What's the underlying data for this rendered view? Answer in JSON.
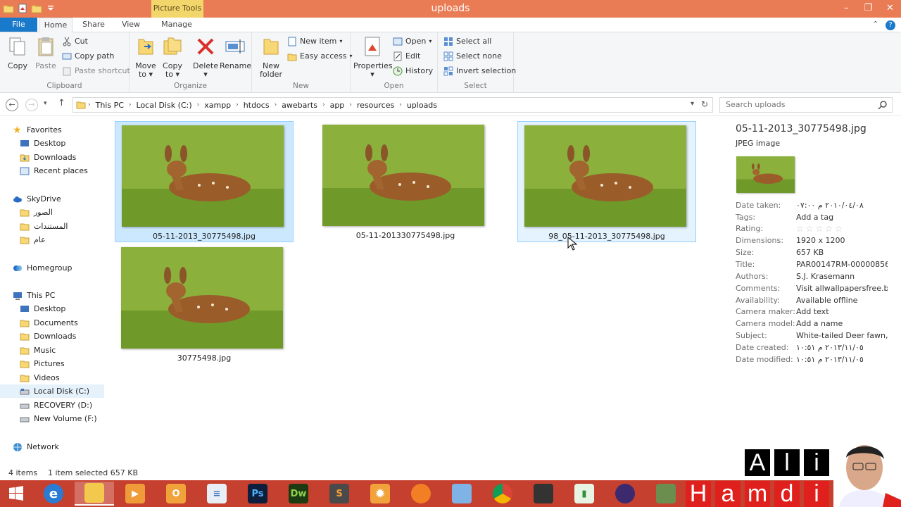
{
  "window": {
    "title": "uploads",
    "context_group": "Picture Tools",
    "controls": [
      "–",
      "❐",
      "✕"
    ]
  },
  "tabs": {
    "file": "File",
    "items": [
      "Home",
      "Share",
      "View",
      "Manage"
    ],
    "active": "Home"
  },
  "ribbon": {
    "clipboard": {
      "label": "Clipboard",
      "copy": "Copy",
      "paste": "Paste",
      "cut": "Cut",
      "copy_path": "Copy path",
      "paste_shortcut": "Paste shortcut"
    },
    "organize": {
      "label": "Organize",
      "move_to": [
        "Move",
        "to"
      ],
      "copy_to": [
        "Copy",
        "to"
      ],
      "delete": "Delete",
      "rename": "Rename"
    },
    "new": {
      "label": "New",
      "new_folder": [
        "New",
        "folder"
      ],
      "new_item": "New item",
      "easy_access": "Easy access"
    },
    "open": {
      "label": "Open",
      "properties": "Properties",
      "open": "Open",
      "edit": "Edit",
      "history": "History"
    },
    "select": {
      "label": "Select",
      "select_all": "Select all",
      "select_none": "Select none",
      "invert_selection": "Invert selection"
    }
  },
  "address": {
    "crumbs": [
      "This PC",
      "Local Disk (C:)",
      "xampp",
      "htdocs",
      "awebarts",
      "app",
      "resources",
      "uploads"
    ]
  },
  "search": {
    "placeholder": "Search uploads"
  },
  "nav": {
    "favorites": "Favorites",
    "fav_items": [
      "Desktop",
      "Downloads",
      "Recent places"
    ],
    "skydrive": "SkyDrive",
    "skydrive_items": [
      "الصور",
      "المستندات",
      "عام"
    ],
    "homegroup": "Homegroup",
    "thispc": "This PC",
    "pc_items": [
      "Desktop",
      "Documents",
      "Downloads",
      "Music",
      "Pictures",
      "Videos",
      "Local Disk (C:)",
      "RECOVERY (D:)",
      "New Volume (F:)"
    ],
    "network": "Network"
  },
  "files": [
    {
      "name": "05-11-2013_30775498.jpg",
      "state": "selected"
    },
    {
      "name": "05-11-201330775498.jpg",
      "state": "normal"
    },
    {
      "name": "98_05-11-2013_30775498.jpg",
      "state": "hover"
    },
    {
      "name": "30775498.jpg",
      "state": "normal"
    }
  ],
  "details": {
    "name": "05-11-2013_30775498.jpg",
    "type": "JPEG image",
    "props": [
      {
        "k": "Date taken:",
        "v": "٢٠١٠/٠٤/٠٨ م ٠٧:٠٠"
      },
      {
        "k": "Tags:",
        "v": "Add a tag"
      },
      {
        "k": "Rating:",
        "v": ""
      },
      {
        "k": "Dimensions:",
        "v": "1920 x 1200"
      },
      {
        "k": "Size:",
        "v": "657 KB"
      },
      {
        "k": "Title:",
        "v": "PAR00147RM-00000856..."
      },
      {
        "k": "Authors:",
        "v": "S.J. Krasemann"
      },
      {
        "k": "Comments:",
        "v": "Visit allwallpapersfree.b..."
      },
      {
        "k": "Availability:",
        "v": "Available offline"
      },
      {
        "k": "Camera maker:",
        "v": "Add text"
      },
      {
        "k": "Camera model:",
        "v": "Add a name"
      },
      {
        "k": "Subject:",
        "v": "White-tailed Deer fawn,..."
      },
      {
        "k": "Date created:",
        "v": "٢٠١٣/١١/٠٥ م ١٠:٥١"
      },
      {
        "k": "Date modified:",
        "v": "٢٠١٣/١١/٠٥ م ١٠:٥١"
      }
    ],
    "rating_stars": 5
  },
  "status": {
    "items": "4 items",
    "selected": "1 item selected  657 KB"
  },
  "taskbar": {
    "apps": [
      "start",
      "internet-explorer",
      "file-explorer",
      "media-player",
      "outlook",
      "notepad",
      "photoshop",
      "dreamweaver",
      "sublime-text",
      "settings",
      "firefox-dev",
      "virtualbox",
      "chrome",
      "camtasia",
      "charts",
      "firefox",
      "utility"
    ],
    "labels": {
      "photoshop": "Ps",
      "dreamweaver": "Dw",
      "sublime-text": "S"
    }
  },
  "watermark": {
    "top": [
      "A",
      "l",
      "i"
    ],
    "bottom": [
      "H",
      "a",
      "m",
      "d",
      "i"
    ]
  },
  "colors": {
    "titlebar": "#e97c55",
    "context": "#f3d66b",
    "file_tab": "#1979ca",
    "selection": "#cce8ff",
    "taskbar": "#c5402f"
  }
}
